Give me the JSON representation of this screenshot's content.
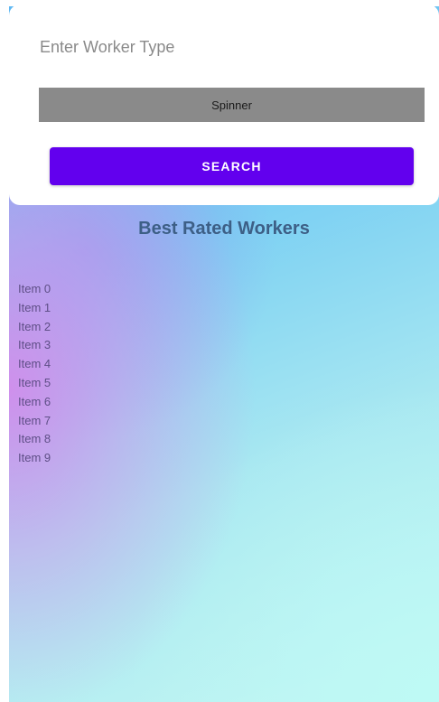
{
  "search": {
    "placeholder": "Enter Worker Type",
    "value": ""
  },
  "spinner": {
    "label": "Spinner"
  },
  "search_button": {
    "label": "SEARCH"
  },
  "section": {
    "title": "Best Rated Workers"
  },
  "workers": [
    "Item 0",
    "Item 1",
    "Item 2",
    "Item 3",
    "Item 4",
    "Item 5",
    "Item 6",
    "Item 7",
    "Item 8",
    "Item 9"
  ],
  "colors": {
    "accent": "#6200ee",
    "spinner_bg": "#8a8a8a",
    "title": "#3d5f86"
  }
}
